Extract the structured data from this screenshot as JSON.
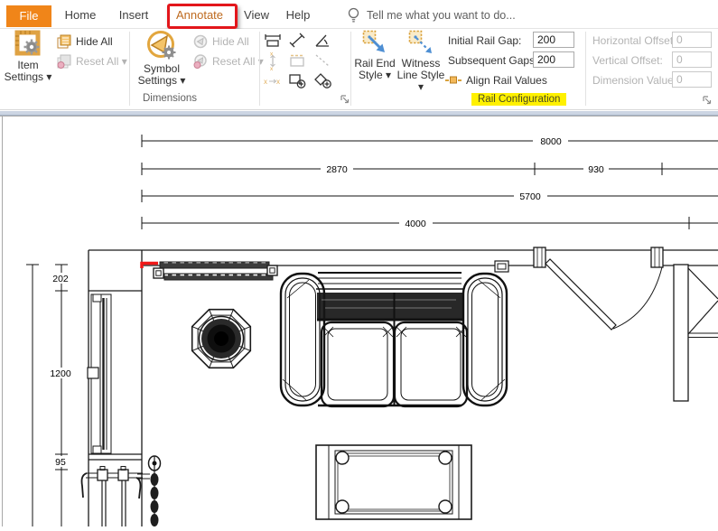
{
  "colors": {
    "accent_orange": "#F08519",
    "annotate_box_red": "#E3161B",
    "highlight_yellow": "#FFF100",
    "rail_arrow_blue": "#4E8FD3",
    "red_wall_mark": "#F01818"
  },
  "tabs": {
    "file": "File",
    "home": "Home",
    "insert": "Insert",
    "annotate": "Annotate",
    "view": "View",
    "help": "Help"
  },
  "tell_me": "Tell me what you want to do...",
  "dimensions_group": {
    "label": "Dimensions",
    "item_settings_1": "Item",
    "item_settings_2": "Settings ▾",
    "hide_all": "Hide All",
    "reset_all": "Reset All ▾",
    "symbol_settings_1": "Symbol",
    "symbol_settings_2": "Settings ▾",
    "hide_all_2": "Hide All",
    "reset_all_2": "Reset All ▾"
  },
  "rail_group": {
    "label": "Rail Configuration",
    "rail_end_1": "Rail End",
    "rail_end_2": "Style ▾",
    "witness_1": "Witness",
    "witness_2": "Line Style ▾",
    "initial_rail_gap_label": "Initial Rail Gap:",
    "initial_rail_gap_value": "200",
    "subsequent_gaps_label": "Subsequent Gaps:",
    "subsequent_gaps_value": "200",
    "align_label": "Align Rail Values",
    "horizontal_offset_label": "Horizontal Offset:",
    "horizontal_offset_value": "0",
    "vertical_offset_label": "Vertical Offset:",
    "vertical_offset_value": "0",
    "dimension_value_label": "Dimension Value:",
    "dimension_value_value": "0"
  },
  "plan": {
    "rail_8000": "8000",
    "rail_2870": "2870",
    "rail_930": "930",
    "rail_5700": "5700",
    "rail_4000": "4000",
    "dim_202": "202",
    "dim_1200": "1200",
    "dim_95": "95"
  }
}
